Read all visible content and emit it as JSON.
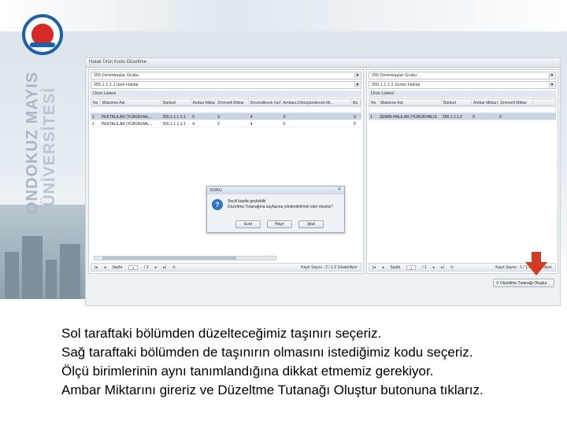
{
  "university": {
    "name_line1": "ONDOKUZ MAYIS",
    "name_line2": "ÜNİVERSİTESİ",
    "colors": {
      "blue": "#1d5fa8",
      "red": "#d62a26"
    }
  },
  "app": {
    "window_title": "Hatalı Ürün Kodu Düzeltme",
    "left": {
      "combo1": "255 Demirbaşlar Grubu",
      "combo2": "255.1.1.1.1 İpek Halılar",
      "section": "Ürün Listesi",
      "columns": [
        "No",
        "Malzeme Adı",
        "Barkod",
        "Ambar Miktarı",
        "Zimmetli Miktar",
        "Devredilecek Gelen",
        "Ambara Dönüştürülecek Mi...",
        "Ba"
      ],
      "rows": [
        [
          "1",
          "PEKTALILAR (YÜRÜKHAL...",
          "255.1.1.1.1-1",
          "5",
          "3",
          "4",
          "0",
          "0"
        ],
        [
          "2",
          "PEKTALILAR (YÜRÜKHAL...",
          "255.1.1.1.1-1",
          "4",
          "2",
          "4",
          "0",
          "0"
        ]
      ],
      "pager": {
        "page_label": "Sayfa",
        "page": "1",
        "of": "/ 1",
        "records": "Kayıt Sayısı : 2 / 1-2 Gösteriliyor"
      }
    },
    "right": {
      "combo1": "255 Demirbaşlar Grubu",
      "combo2": "255.1.1.1.2 Zemin Halılar",
      "section": "Ürün Listesi",
      "columns": [
        "No",
        "Malzeme Adı",
        "Barkod",
        "Ambar Miktarı",
        "Zimmetli Miktar"
      ],
      "rows": [
        [
          "1",
          "ZEMİN HALILAR (YÜRÜKHALIS",
          "255.1.1.1.2",
          "0",
          "0"
        ]
      ],
      "pager": {
        "page_label": "Sayfa",
        "page": "1",
        "of": "/ 1",
        "records": "Kayıt Sayısı : 1 / 1-1 Gösteriliyor"
      }
    },
    "create_button": "Düzeltme Tutanağı Oluştur",
    "dialog": {
      "title": "SORU",
      "line1": "Seçili kayda geçilebilir",
      "line2": "Düzeltme Tutanağına sayfasına yönlendirilmek ister misiniz?",
      "buttons": [
        "Evet",
        "Hayır",
        "İptal"
      ],
      "close": "✕",
      "icon": "question-icon"
    }
  },
  "caption": [
    "Sol taraftaki bölümden düzelteceğimiz taşınırı seçeriz.",
    "Sağ taraftaki bölümden de taşınırın olmasını istediğimiz kodu seçeriz.",
    "Ölçü birimlerinin aynı tanımlandığına dikkat etmemiz gerekiyor.",
    "Ambar Miktarını gireriz ve Düzeltme Tutanağı Oluştur butonuna tıklarız."
  ]
}
